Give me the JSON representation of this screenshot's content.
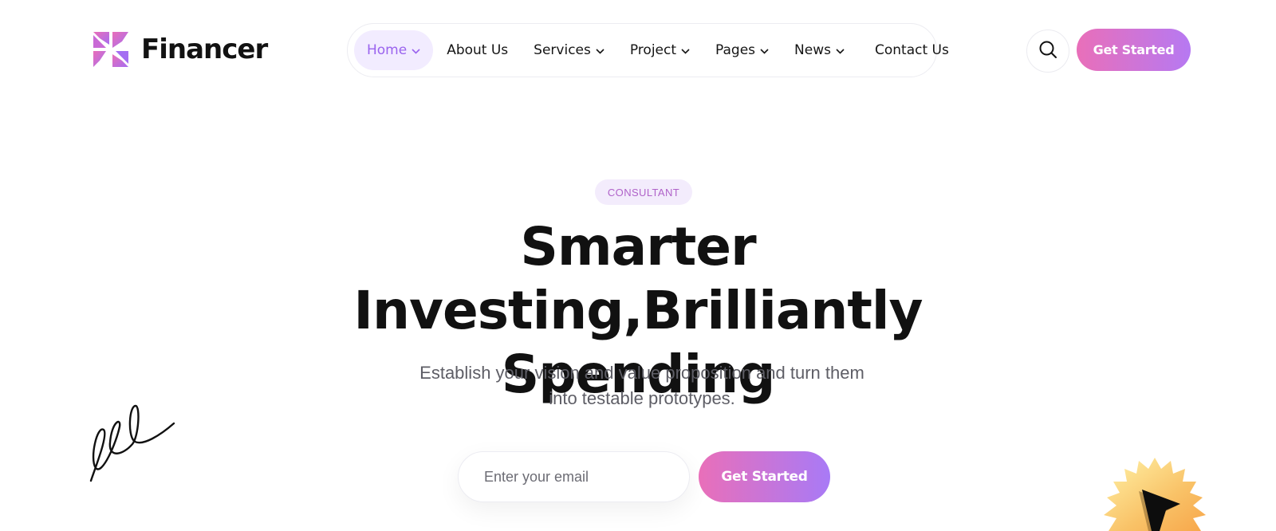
{
  "brand": {
    "name": "Financer",
    "logo_icon": "pinwheel-icon",
    "accent": "#9a63ee",
    "gradient_start": "#e96fb9",
    "gradient_end": "#a87af6"
  },
  "nav": {
    "items": [
      {
        "label": "Home",
        "has_dropdown": true,
        "active": true
      },
      {
        "label": "About Us",
        "has_dropdown": false
      },
      {
        "label": "Services",
        "has_dropdown": true
      },
      {
        "label": "Project",
        "has_dropdown": true
      },
      {
        "label": "Pages",
        "has_dropdown": true
      },
      {
        "label": "News",
        "has_dropdown": true
      },
      {
        "label": "Contact Us",
        "has_dropdown": false
      }
    ]
  },
  "header": {
    "search_icon": "search-icon",
    "cta_label": "Get Started"
  },
  "hero": {
    "badge": "CONSULTANT",
    "title_line1": "Smarter Investing,Brilliantly",
    "title_line2": "Spending",
    "subtitle_line1": "Establish your vision and value proposition and turn them",
    "subtitle_line2": "into testable prototypes.",
    "email_placeholder": "Enter your email",
    "cta_label": "Get Started"
  },
  "decorations": {
    "left": "signature-scribble",
    "right": "starburst-cursor-icon"
  }
}
